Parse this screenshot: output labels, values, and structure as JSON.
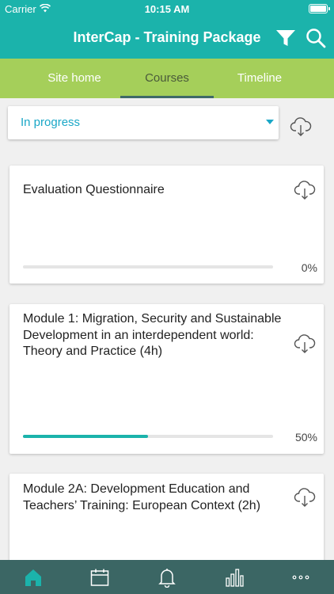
{
  "status_bar": {
    "carrier": "Carrier",
    "time": "10:15 AM"
  },
  "header": {
    "title": "InterCap - Training Package",
    "icons": [
      "filter-icon",
      "search-icon"
    ]
  },
  "tabs": [
    {
      "label": "Site home",
      "active": false
    },
    {
      "label": "Courses",
      "active": true
    },
    {
      "label": "Timeline",
      "active": false
    }
  ],
  "filter": {
    "selected": "In progress"
  },
  "courses": [
    {
      "title": "Evaluation Questionnaire",
      "progress": 0,
      "progress_label": "0%"
    },
    {
      "title": "Module 1: Migration, Security and Sustainable Development in an interdependent world: Theory and Practice (4h)",
      "progress": 50,
      "progress_label": "50%"
    },
    {
      "title": "Module 2A: Development Education and Teachers’ Training: European Context (2h)",
      "progress": null,
      "progress_label": ""
    }
  ],
  "bottom_nav": [
    {
      "icon": "home-icon",
      "active": true
    },
    {
      "icon": "calendar-icon",
      "active": false
    },
    {
      "icon": "bell-icon",
      "active": false
    },
    {
      "icon": "chart-icon",
      "active": false
    },
    {
      "icon": "more-icon",
      "active": false
    }
  ],
  "colors": {
    "primary": "#1bb3ab",
    "accent_green": "#a5cf5a",
    "nav_dark": "#3b6664",
    "link": "#1aa7c7"
  }
}
